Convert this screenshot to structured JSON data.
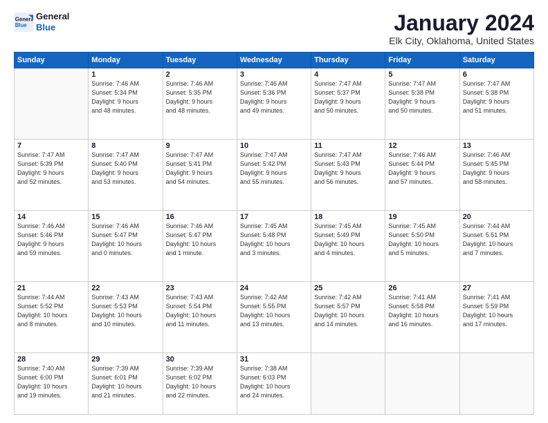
{
  "logo": {
    "line1": "General",
    "line2": "Blue"
  },
  "title": "January 2024",
  "subtitle": "Elk City, Oklahoma, United States",
  "days_header": [
    "Sunday",
    "Monday",
    "Tuesday",
    "Wednesday",
    "Thursday",
    "Friday",
    "Saturday"
  ],
  "weeks": [
    [
      {
        "num": "",
        "info": ""
      },
      {
        "num": "1",
        "info": "Sunrise: 7:46 AM\nSunset: 5:34 PM\nDaylight: 9 hours\nand 48 minutes."
      },
      {
        "num": "2",
        "info": "Sunrise: 7:46 AM\nSunset: 5:35 PM\nDaylight: 9 hours\nand 48 minutes."
      },
      {
        "num": "3",
        "info": "Sunrise: 7:46 AM\nSunset: 5:36 PM\nDaylight: 9 hours\nand 49 minutes."
      },
      {
        "num": "4",
        "info": "Sunrise: 7:47 AM\nSunset: 5:37 PM\nDaylight: 9 hours\nand 50 minutes."
      },
      {
        "num": "5",
        "info": "Sunrise: 7:47 AM\nSunset: 5:38 PM\nDaylight: 9 hours\nand 50 minutes."
      },
      {
        "num": "6",
        "info": "Sunrise: 7:47 AM\nSunset: 5:38 PM\nDaylight: 9 hours\nand 51 minutes."
      }
    ],
    [
      {
        "num": "7",
        "info": "Sunrise: 7:47 AM\nSunset: 5:39 PM\nDaylight: 9 hours\nand 52 minutes."
      },
      {
        "num": "8",
        "info": "Sunrise: 7:47 AM\nSunset: 5:40 PM\nDaylight: 9 hours\nand 53 minutes."
      },
      {
        "num": "9",
        "info": "Sunrise: 7:47 AM\nSunset: 5:41 PM\nDaylight: 9 hours\nand 54 minutes."
      },
      {
        "num": "10",
        "info": "Sunrise: 7:47 AM\nSunset: 5:42 PM\nDaylight: 9 hours\nand 55 minutes."
      },
      {
        "num": "11",
        "info": "Sunrise: 7:47 AM\nSunset: 5:43 PM\nDaylight: 9 hours\nand 56 minutes."
      },
      {
        "num": "12",
        "info": "Sunrise: 7:46 AM\nSunset: 5:44 PM\nDaylight: 9 hours\nand 57 minutes."
      },
      {
        "num": "13",
        "info": "Sunrise: 7:46 AM\nSunset: 5:45 PM\nDaylight: 9 hours\nand 58 minutes."
      }
    ],
    [
      {
        "num": "14",
        "info": "Sunrise: 7:46 AM\nSunset: 5:46 PM\nDaylight: 9 hours\nand 59 minutes."
      },
      {
        "num": "15",
        "info": "Sunrise: 7:46 AM\nSunset: 5:47 PM\nDaylight: 10 hours\nand 0 minutes."
      },
      {
        "num": "16",
        "info": "Sunrise: 7:46 AM\nSunset: 5:47 PM\nDaylight: 10 hours\nand 1 minute."
      },
      {
        "num": "17",
        "info": "Sunrise: 7:45 AM\nSunset: 5:48 PM\nDaylight: 10 hours\nand 3 minutes."
      },
      {
        "num": "18",
        "info": "Sunrise: 7:45 AM\nSunset: 5:49 PM\nDaylight: 10 hours\nand 4 minutes."
      },
      {
        "num": "19",
        "info": "Sunrise: 7:45 AM\nSunset: 5:50 PM\nDaylight: 10 hours\nand 5 minutes."
      },
      {
        "num": "20",
        "info": "Sunrise: 7:44 AM\nSunset: 5:51 PM\nDaylight: 10 hours\nand 7 minutes."
      }
    ],
    [
      {
        "num": "21",
        "info": "Sunrise: 7:44 AM\nSunset: 5:52 PM\nDaylight: 10 hours\nand 8 minutes."
      },
      {
        "num": "22",
        "info": "Sunrise: 7:43 AM\nSunset: 5:53 PM\nDaylight: 10 hours\nand 10 minutes."
      },
      {
        "num": "23",
        "info": "Sunrise: 7:43 AM\nSunset: 5:54 PM\nDaylight: 10 hours\nand 11 minutes."
      },
      {
        "num": "24",
        "info": "Sunrise: 7:42 AM\nSunset: 5:55 PM\nDaylight: 10 hours\nand 13 minutes."
      },
      {
        "num": "25",
        "info": "Sunrise: 7:42 AM\nSunset: 5:57 PM\nDaylight: 10 hours\nand 14 minutes."
      },
      {
        "num": "26",
        "info": "Sunrise: 7:41 AM\nSunset: 5:58 PM\nDaylight: 10 hours\nand 16 minutes."
      },
      {
        "num": "27",
        "info": "Sunrise: 7:41 AM\nSunset: 5:59 PM\nDaylight: 10 hours\nand 17 minutes."
      }
    ],
    [
      {
        "num": "28",
        "info": "Sunrise: 7:40 AM\nSunset: 6:00 PM\nDaylight: 10 hours\nand 19 minutes."
      },
      {
        "num": "29",
        "info": "Sunrise: 7:39 AM\nSunset: 6:01 PM\nDaylight: 10 hours\nand 21 minutes."
      },
      {
        "num": "30",
        "info": "Sunrise: 7:39 AM\nSunset: 6:02 PM\nDaylight: 10 hours\nand 22 minutes."
      },
      {
        "num": "31",
        "info": "Sunrise: 7:38 AM\nSunset: 6:03 PM\nDaylight: 10 hours\nand 24 minutes."
      },
      {
        "num": "",
        "info": ""
      },
      {
        "num": "",
        "info": ""
      },
      {
        "num": "",
        "info": ""
      }
    ]
  ]
}
